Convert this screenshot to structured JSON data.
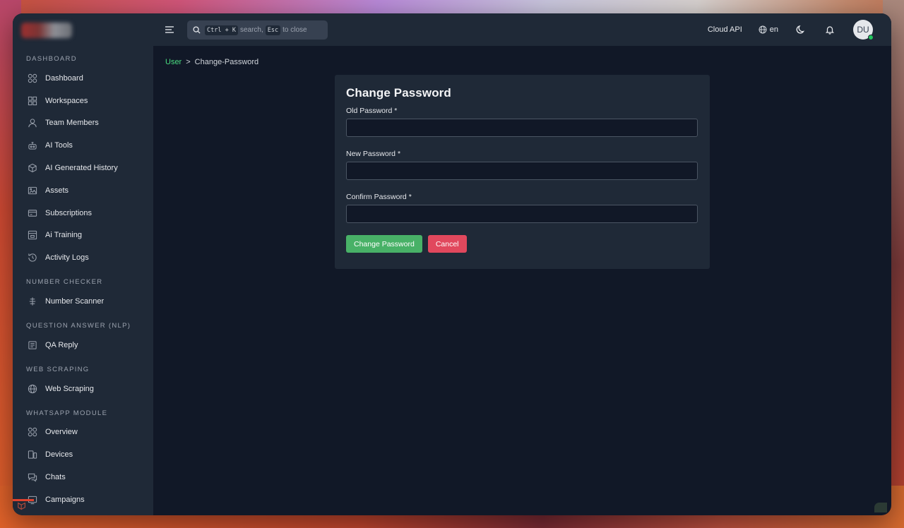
{
  "topbar": {
    "search_hint_key1": "Ctrl + K",
    "search_hint_text1": "search,",
    "search_hint_key2": "Esc",
    "search_hint_text2": "to close",
    "cloud_api": "Cloud API",
    "language": "en",
    "avatar_initials": "DU"
  },
  "sidebar": {
    "sections": [
      {
        "title": "DASHBOARD",
        "items": [
          {
            "label": "Dashboard",
            "icon": "dashboard-icon"
          },
          {
            "label": "Workspaces",
            "icon": "grid-icon"
          },
          {
            "label": "Team Members",
            "icon": "user-icon"
          },
          {
            "label": "AI Tools",
            "icon": "robot-icon"
          },
          {
            "label": "AI Generated History",
            "icon": "cube-icon"
          },
          {
            "label": "Assets",
            "icon": "image-icon"
          },
          {
            "label": "Subscriptions",
            "icon": "card-icon"
          },
          {
            "label": "Ai Training",
            "icon": "training-icon"
          },
          {
            "label": "Activity Logs",
            "icon": "history-icon"
          }
        ]
      },
      {
        "title": "NUMBER CHECKER",
        "items": [
          {
            "label": "Number Scanner",
            "icon": "scanner-icon"
          }
        ]
      },
      {
        "title": "QUESTION ANSWER (NLP)",
        "items": [
          {
            "label": "QA Reply",
            "icon": "document-icon"
          }
        ]
      },
      {
        "title": "WEB SCRAPING",
        "items": [
          {
            "label": "Web Scraping",
            "icon": "globe-icon"
          }
        ]
      },
      {
        "title": "WHATSAPP MODULE",
        "items": [
          {
            "label": "Overview",
            "icon": "dashboard-icon"
          },
          {
            "label": "Devices",
            "icon": "devices-icon"
          },
          {
            "label": "Chats",
            "icon": "chat-icon"
          },
          {
            "label": "Campaigns",
            "icon": "campaign-icon"
          }
        ]
      }
    ]
  },
  "breadcrumb": {
    "parent": "User",
    "separator": ">",
    "current": "Change-Password"
  },
  "form": {
    "title": "Change Password",
    "old_password_label": "Old Password *",
    "new_password_label": "New Password *",
    "confirm_password_label": "Confirm Password *",
    "old_password_value": "",
    "new_password_value": "",
    "confirm_password_value": "",
    "submit_label": "Change Password",
    "cancel_label": "Cancel"
  },
  "colors": {
    "accent_green": "#48b167",
    "danger_red": "#e1485d",
    "link_green": "#4ade80",
    "sidebar_bg": "#1f2937",
    "main_bg": "#111827"
  }
}
